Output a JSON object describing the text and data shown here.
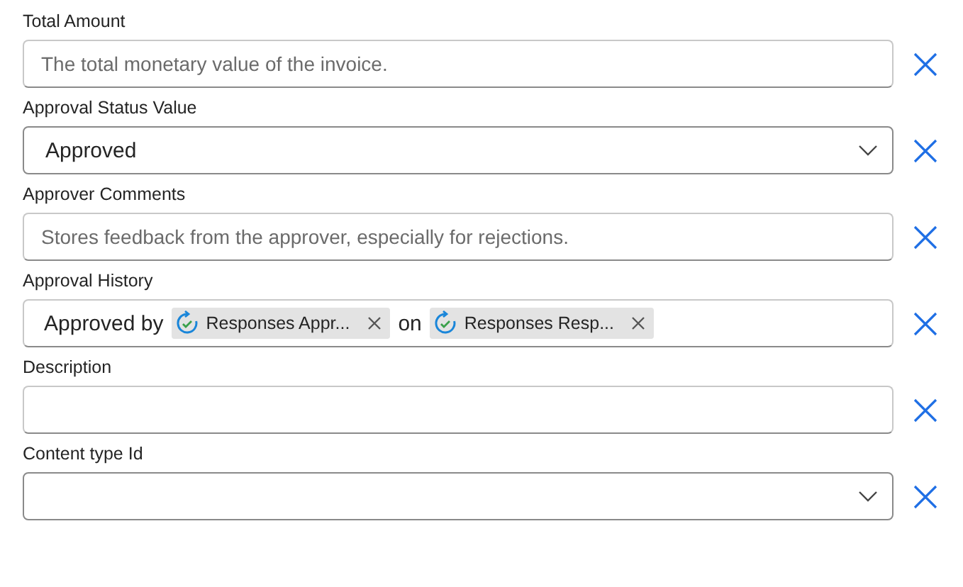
{
  "fields": [
    {
      "label": "Total Amount",
      "kind": "text",
      "placeholder": "The total monetary value of the invoice."
    },
    {
      "label": "Approval Status Value",
      "kind": "dropdown",
      "value": "Approved"
    },
    {
      "label": "Approver Comments",
      "kind": "text",
      "placeholder": "Stores feedback from the approver, especially for rejections."
    },
    {
      "label": "Approval History",
      "kind": "expression",
      "parts": [
        {
          "kind": "text",
          "text": "Approved by"
        },
        {
          "kind": "token",
          "text": "Responses Appr..."
        },
        {
          "kind": "text",
          "text": "on"
        },
        {
          "kind": "token",
          "text": "Responses Resp..."
        }
      ]
    },
    {
      "label": "Description",
      "kind": "text"
    },
    {
      "label": "Content type Id",
      "kind": "dropdown"
    }
  ]
}
